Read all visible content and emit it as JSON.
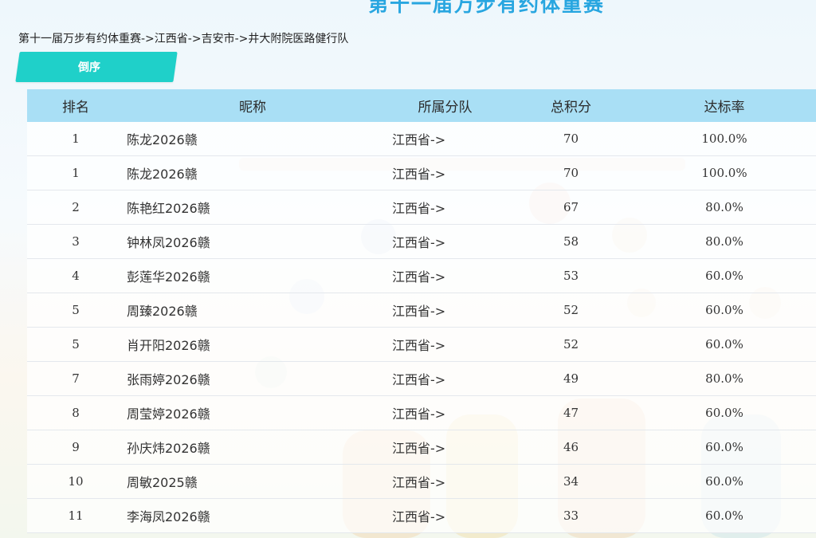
{
  "header": {
    "title": "第十一届万步有约体重赛",
    "breadcrumb": "第十一届万步有约体重赛->江西省->吉安市->井大附院医路健行队",
    "sort_button": "倒序"
  },
  "table": {
    "columns": [
      "排名",
      "昵称",
      "所属分队",
      "总积分",
      "达标率"
    ],
    "rows": [
      {
        "rank": "1",
        "name": "陈龙2026赣",
        "team": "江西省->",
        "score": "70",
        "rate": "100.0%"
      },
      {
        "rank": "1",
        "name": "陈龙2026赣",
        "team": "江西省->",
        "score": "70",
        "rate": "100.0%"
      },
      {
        "rank": "2",
        "name": "陈艳红2026赣",
        "team": "江西省->",
        "score": "67",
        "rate": "80.0%"
      },
      {
        "rank": "3",
        "name": "钟林凤2026赣",
        "team": "江西省->",
        "score": "58",
        "rate": "80.0%"
      },
      {
        "rank": "4",
        "name": "彭莲华2026赣",
        "team": "江西省->",
        "score": "53",
        "rate": "60.0%"
      },
      {
        "rank": "5",
        "name": "周臻2026赣",
        "team": "江西省->",
        "score": "52",
        "rate": "60.0%"
      },
      {
        "rank": "5",
        "name": "肖开阳2026赣",
        "team": "江西省->",
        "score": "52",
        "rate": "60.0%"
      },
      {
        "rank": "7",
        "name": "张雨婷2026赣",
        "team": "江西省->",
        "score": "49",
        "rate": "80.0%"
      },
      {
        "rank": "8",
        "name": "周莹婷2026赣",
        "team": "江西省->",
        "score": "47",
        "rate": "60.0%"
      },
      {
        "rank": "9",
        "name": "孙庆炜2026赣",
        "team": "江西省->",
        "score": "46",
        "rate": "60.0%"
      },
      {
        "rank": "10",
        "name": "周敏2025赣",
        "team": "江西省->",
        "score": "34",
        "rate": "60.0%"
      },
      {
        "rank": "11",
        "name": "李海凤2026赣",
        "team": "江西省->",
        "score": "33",
        "rate": "60.0%"
      }
    ]
  },
  "colors": {
    "accent_button": "#1fd0c9",
    "header_row": "#a9dff5",
    "highlight_text": "#c81a1a",
    "title_text": "#28a6e0"
  }
}
